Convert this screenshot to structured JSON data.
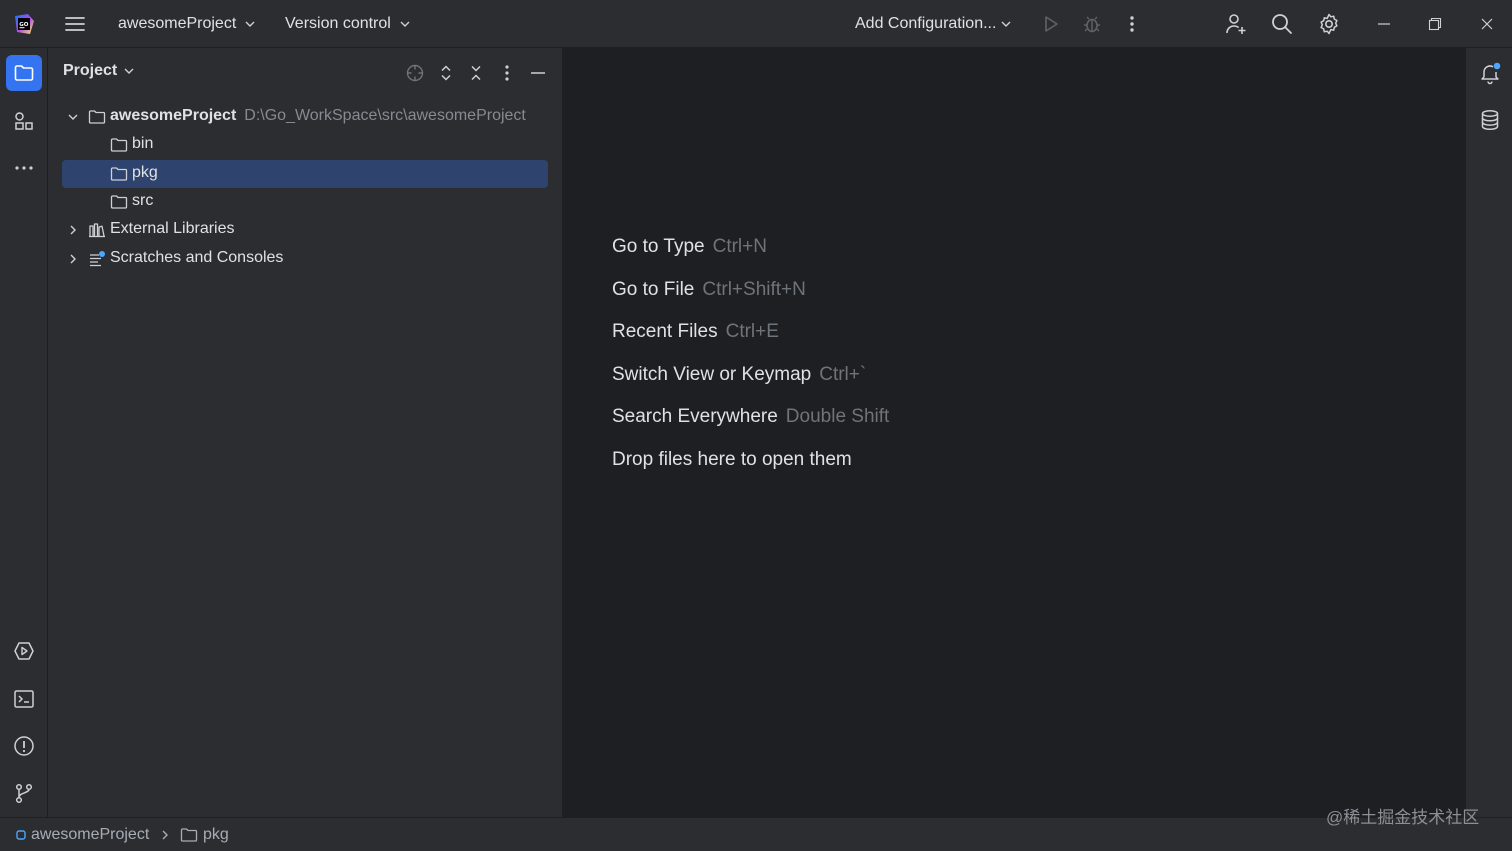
{
  "titlebar": {
    "project_name": "awesomeProject",
    "vcs_label": "Version control",
    "run_config_label": "Add Configuration...",
    "icons": {
      "app": "goland-logo",
      "menu": "hamburger-icon",
      "run": "play-icon",
      "debug": "bug-icon",
      "more": "vertical-dots-icon",
      "add_user": "add-user-icon",
      "search": "search-icon",
      "settings": "gear-icon",
      "minimize": "minimize-icon",
      "restore": "restore-icon",
      "close": "close-icon"
    }
  },
  "left_strip": {
    "top": [
      "project-folder-icon",
      "structure-icon",
      "more-horizontal-icon"
    ],
    "bottom": [
      "services-icon",
      "terminal-icon",
      "problems-icon",
      "git-icon"
    ]
  },
  "project_panel": {
    "title": "Project",
    "tree": [
      {
        "label": "awesomeProject",
        "path": "D:\\Go_WorkSpace\\src\\awesomeProject",
        "expanded": true
      },
      {
        "label": "bin"
      },
      {
        "label": "pkg",
        "selected": true
      },
      {
        "label": "src"
      },
      {
        "label": "External Libraries",
        "expanded": false
      },
      {
        "label": "Scratches and Consoles",
        "expanded": false
      }
    ]
  },
  "editor_hints": [
    {
      "action": "Go to Type",
      "shortcut": "Ctrl+N"
    },
    {
      "action": "Go to File",
      "shortcut": "Ctrl+Shift+N"
    },
    {
      "action": "Recent Files",
      "shortcut": "Ctrl+E"
    },
    {
      "action": "Switch View or Keymap",
      "shortcut": "Ctrl+`"
    },
    {
      "action": "Search Everywhere",
      "shortcut": "Double Shift"
    },
    {
      "action": "Drop files here to open them",
      "shortcut": ""
    }
  ],
  "right_strip": [
    "notifications-icon",
    "database-icon"
  ],
  "statusbar": {
    "breadcrumb": [
      "awesomeProject",
      "pkg"
    ]
  },
  "watermark": "@稀土掘金技术社区",
  "colors": {
    "accent": "#3574f0",
    "selection": "#2e436e",
    "notification_dot": "#4aa6ff"
  }
}
